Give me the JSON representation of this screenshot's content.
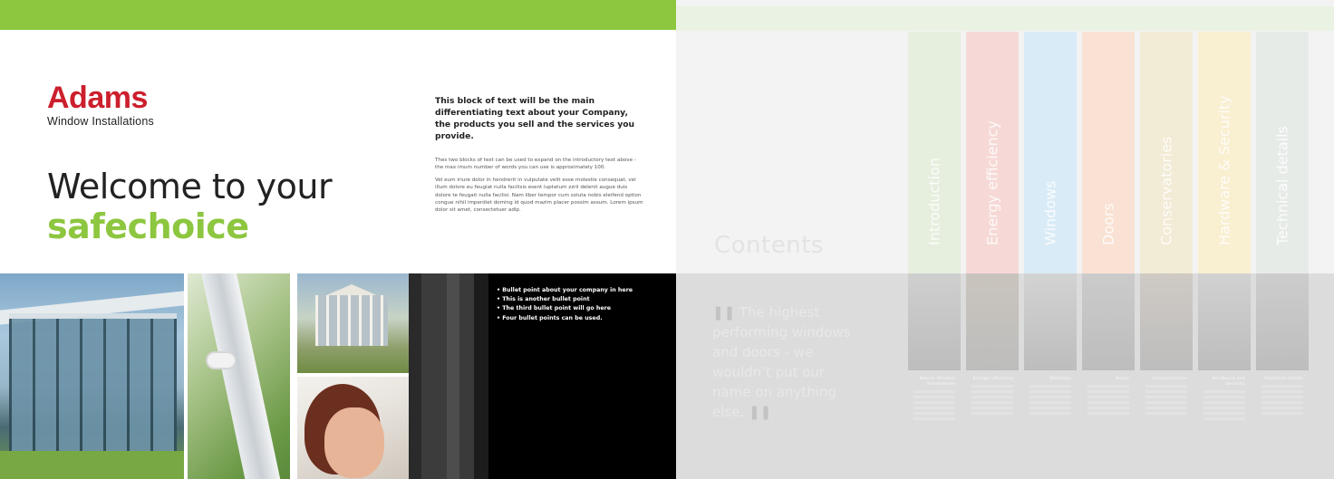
{
  "colors": {
    "brand_green": "#8dc63f",
    "brand_red": "#cc1f2d",
    "panel_black": "#000000"
  },
  "logo": {
    "name": "Adams",
    "subtitle": "Window Installations"
  },
  "welcome": {
    "line1": "Welcome to your",
    "line2": "safechoice"
  },
  "intro": {
    "heading": "This block of text will be the main differentiating text about your Company, the products you sell and the services you provide.",
    "paragraphs": [
      "Thes two blocks of text can be used to expand on the introductory text above - the max imum number of words you can use is approximately  100.",
      "Vel eum iriure dolor in hendrerit in vulputate velit esse molestie consequat, vel illum dolore eu feugiat nulla facilisis esent luptatum zzril delenit augue duis dolore te feugait nulla facilisi. Nam liber tempor cum soluta nobis eleifend option congue nihil imperdiet doming id quod mazim placer possim assum. Lorem ipsum dolor sit amet, consectetuer adip."
    ]
  },
  "bullets": [
    "• Bullet point about your company in here",
    "• This is another bullet point",
    "• The third bullet point will go here",
    "• Four bullet points can be used."
  ],
  "contents": {
    "title": "Contents",
    "quote": "The highest performing windows and doors - we wouldn’t put our name on anything else.",
    "quote_open": "❚❚",
    "quote_close": "❚❚"
  },
  "sections": [
    {
      "label": "Introduction",
      "color": "#e6efde",
      "heading": "Adams Window Installations"
    },
    {
      "label": "Energy efficiency",
      "color": "#f6d9d6",
      "heading": "Energy efficiency"
    },
    {
      "label": "Windows",
      "color": "#d9ebf6",
      "heading": "Windows"
    },
    {
      "label": "Doors",
      "color": "#f9e2d3",
      "heading": "Doors"
    },
    {
      "label": "Conservatories",
      "color": "#f2ebd6",
      "heading": "Conservatories"
    },
    {
      "label": "Hardware & Security",
      "color": "#f9efd1",
      "heading": "Hardware and Security"
    },
    {
      "label": "Technical details",
      "color": "#e6ebe8",
      "heading": "Technical details"
    }
  ]
}
